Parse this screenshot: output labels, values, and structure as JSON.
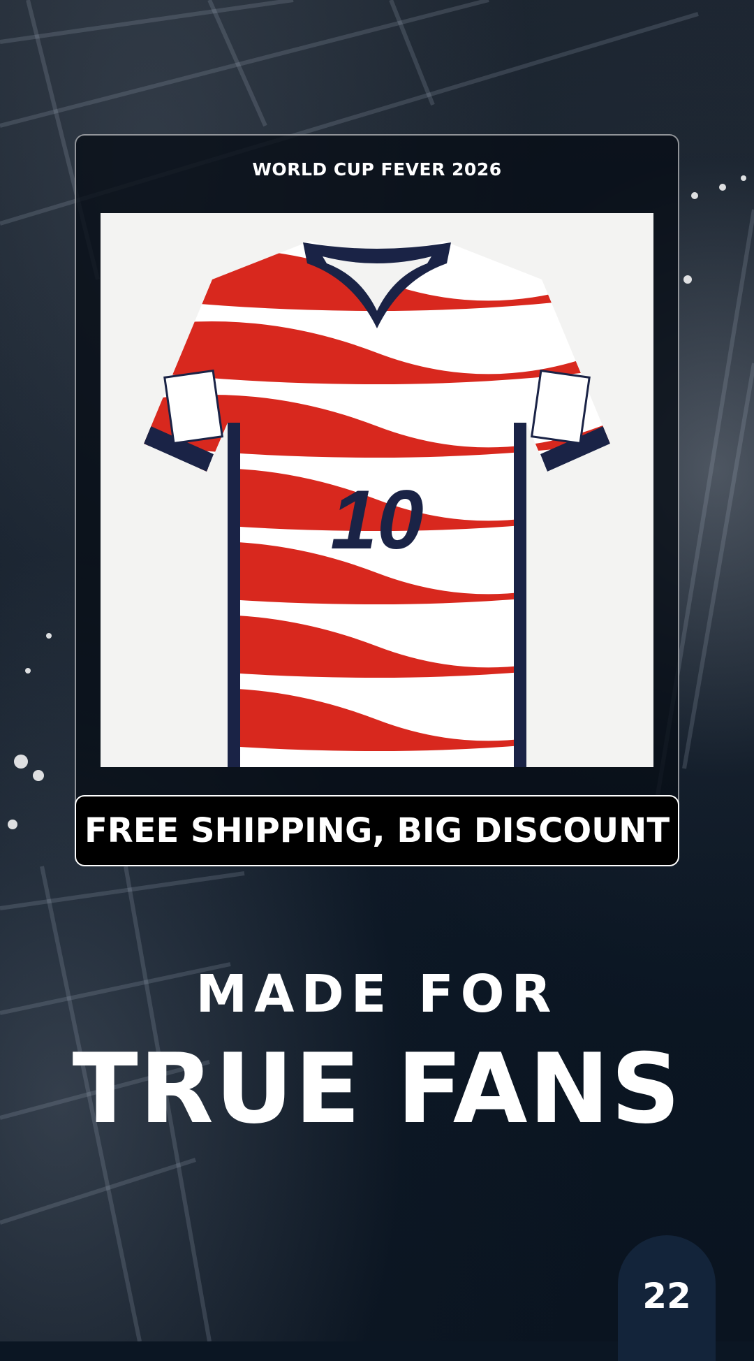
{
  "eyebrow": "WORLD CUP FEVER 2026",
  "product": {
    "image_description": "Red and white wavy striped soccer jersey with navy collar and number 10",
    "jersey_number": "10"
  },
  "promo": "FREE SHIPPING, BIG DISCOUNT",
  "headline": {
    "line1": "MADE FOR",
    "line2": "TRUE FANS"
  },
  "page_number": "22",
  "colors": {
    "background": "#0b1623",
    "stripe_red": "#d8281e",
    "navy": "#1a2346",
    "badge": "#13243a"
  }
}
